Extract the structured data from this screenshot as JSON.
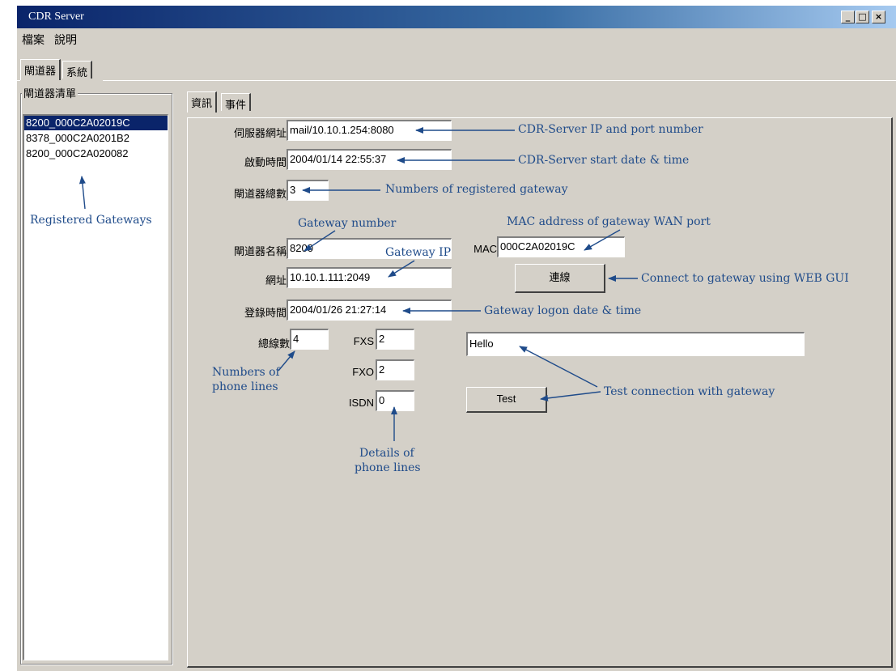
{
  "window": {
    "title": "CDR Server",
    "controls": {
      "minimize": "_",
      "maximize": "□",
      "close": "×"
    }
  },
  "menu": [
    "檔案",
    "說明"
  ],
  "main_tabs": [
    "閘道器",
    "系統"
  ],
  "gateway_list": {
    "title": "閘道器清單",
    "items": [
      "8200_000C2A02019C",
      "8378_000C2A0201B2",
      "8200_000C2A020082"
    ],
    "selected_index": 0
  },
  "sub_tabs": [
    "資訊",
    "事件"
  ],
  "info": {
    "server_address_label": "伺服器網址",
    "server_address_value": "mail/10.10.1.254:8080",
    "start_time_label": "啟動時間",
    "start_time_value": "2004/01/14 22:55:37",
    "gateway_count_label": "閘道器總數",
    "gateway_count_value": "3",
    "gateway_name_label": "閘道器名稱",
    "gateway_name_value": "8200",
    "mac_label": "MAC",
    "mac_value": "000C2A02019C",
    "address_label": "網址",
    "address_value": "10.10.1.111:2049",
    "connect_button": "連線",
    "logon_time_label": "登錄時間",
    "logon_time_value": "2004/01/26 21:27:14",
    "total_lines_label": "總線數",
    "total_lines_value": "4",
    "fxs_label": "FXS",
    "fxs_value": "2",
    "fxo_label": "FXO",
    "fxo_value": "2",
    "isdn_label": "ISDN",
    "isdn_value": "0",
    "test_message_value": "Hello",
    "test_button": "Test"
  },
  "annotations": {
    "registered_gateways": "Registered Gateways",
    "server_ip": "CDR-Server IP and port number",
    "server_start": "CDR-Server start date & time",
    "registered_count": "Numbers of registered gateway",
    "gateway_number": "Gateway number",
    "mac_wan": "MAC address of gateway WAN port",
    "gateway_ip": "Gateway IP",
    "connect_web": "Connect to gateway using WEB GUI",
    "logon_time": "Gateway logon date & time",
    "phone_lines_1": "Numbers of",
    "phone_lines_2": "phone lines",
    "test_connection": "Test connection with gateway",
    "details_1": "Details of",
    "details_2": "phone lines"
  },
  "colors": {
    "title_bar": "#0a246a",
    "annotation": "#1f4b8a",
    "window_bg": "#d4d0c8",
    "selection": "#0a246a"
  }
}
